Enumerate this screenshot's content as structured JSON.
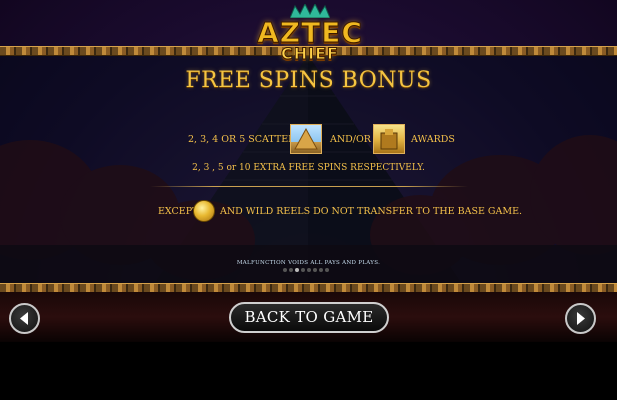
{
  "logo": {
    "line1": "AZTEC",
    "line2": "CHIEF"
  },
  "title": "FREE SPINS BONUS",
  "rule_line1": {
    "prefix": "2, 3, 4 OR 5 SCATTERED",
    "middle": "AND/OR",
    "suffix": "AWARDS",
    "symbol1_icon": "pyramid-scatter-symbol",
    "symbol2_icon": "temple-scatter-symbol"
  },
  "rule_line2": "2, 3 , 5 or 10 EXTRA FREE SPINS RESPECTIVELY.",
  "rule_line3": {
    "prefix": "EXCEPT",
    "suffix": "AND WILD REELS DO NOT TRANSFER TO THE BASE GAME.",
    "coin_icon": "gold-coin-symbol"
  },
  "disclaimer": "MALFUNCTION VOIDS ALL PAYS AND PLAYS.",
  "pagination": {
    "pages": 8,
    "current": 3
  },
  "buttons": {
    "back_to_game": "BACK TO GAME",
    "prev_icon": "arrow-left-icon",
    "next_icon": "arrow-right-icon"
  },
  "colors": {
    "text_gold": "#f3c04a",
    "title_gold": "#f5c542",
    "disclaimer": "#c9dff0"
  }
}
